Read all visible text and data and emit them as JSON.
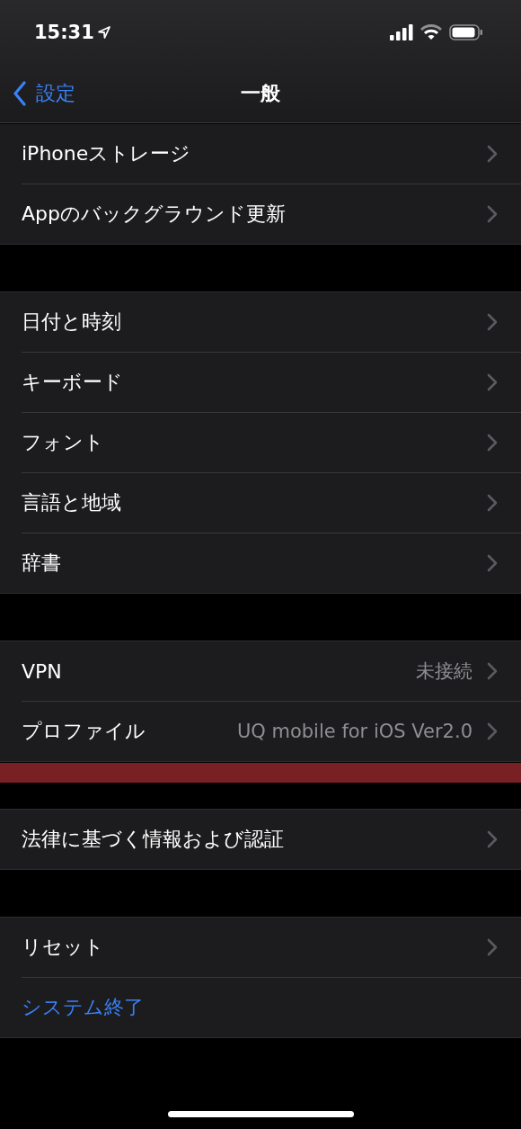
{
  "status_bar": {
    "time": "15:31"
  },
  "nav": {
    "back": "設定",
    "title": "一般"
  },
  "groups": [
    {
      "rows": [
        {
          "kind": "link",
          "label": "iPhoneストレージ"
        },
        {
          "kind": "link",
          "label": "Appのバックグラウンド更新"
        }
      ]
    },
    {
      "rows": [
        {
          "kind": "link",
          "label": "日付と時刻"
        },
        {
          "kind": "link",
          "label": "キーボード"
        },
        {
          "kind": "link",
          "label": "フォント"
        },
        {
          "kind": "link",
          "label": "言語と地域"
        },
        {
          "kind": "link",
          "label": "辞書"
        }
      ]
    },
    {
      "rows": [
        {
          "kind": "link",
          "label": "VPN",
          "value": "未接続"
        },
        {
          "kind": "link",
          "label": "プロファイル",
          "value": "UQ mobile for iOS Ver2.0",
          "highlighted": true
        }
      ]
    },
    {
      "rows": [
        {
          "kind": "link",
          "label": "法律に基づく情報および認証"
        }
      ]
    },
    {
      "rows": [
        {
          "kind": "link",
          "label": "リセット"
        },
        {
          "kind": "action",
          "label": "システム終了"
        }
      ]
    }
  ]
}
